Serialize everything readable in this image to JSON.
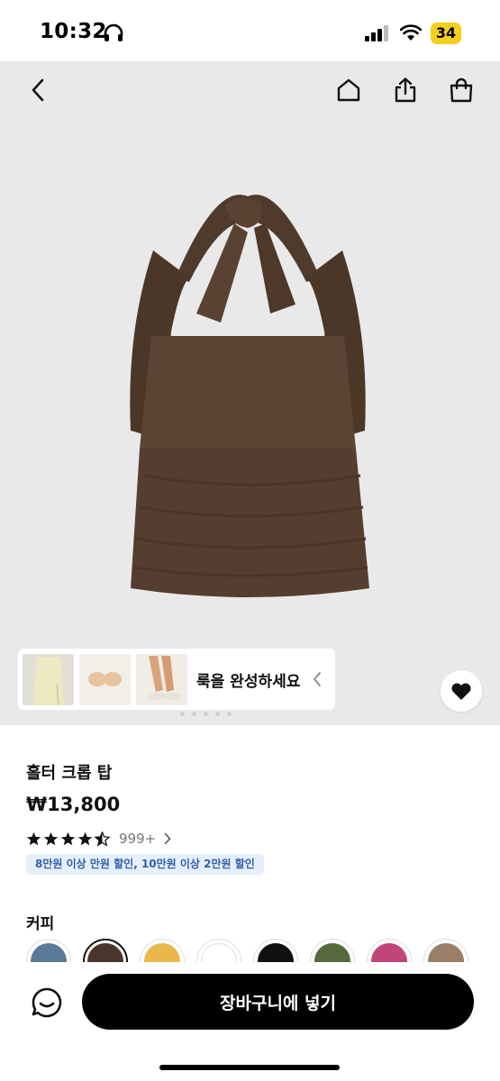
{
  "status_bar": {
    "time": "10:32",
    "battery": "34"
  },
  "product": {
    "title": "홀터 크롭 탑",
    "price": "₩13,800",
    "rating": 4.5,
    "review_count": "999+",
    "promo": "8만원 이상 만원 할인, 10만원 이상 2만원 할인"
  },
  "look": {
    "label": "룩을 완성하세요"
  },
  "color": {
    "label": "커피",
    "swatches": [
      "#5b7a99",
      "#4a362b",
      "#e8b84a",
      "#ffffff",
      "#111111",
      "#566a3d",
      "#c2457a",
      "#9a7e66"
    ],
    "selected_index": 1
  },
  "cart_button_label": "장바구니에 넣기",
  "colors": {
    "product": "#5a4333",
    "hero_bg": "#e9e9e9",
    "promo_text": "#2f5fa8",
    "battery": "#f4cf1e"
  }
}
